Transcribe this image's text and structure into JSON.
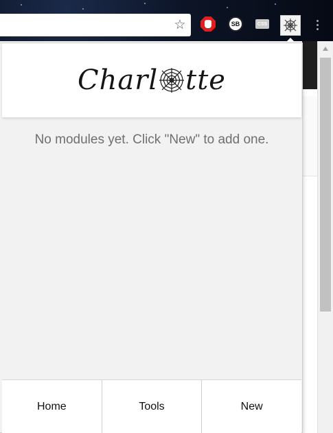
{
  "app": {
    "name": "Charlotte"
  },
  "popup": {
    "logo_prefix": "Charl",
    "logo_suffix": "tte",
    "empty_message": "No modules yet. Click \"New\" to add one.",
    "nav": {
      "home": "Home",
      "tools": "Tools",
      "new": "New"
    }
  },
  "toolbar": {
    "sb_label": "SB",
    "css_label": "CSS"
  },
  "icons": {
    "bookmark": "star-icon",
    "adblock": "adblock-stop-icon",
    "sb": "sb-extension-icon",
    "css": "css-extension-icon",
    "charlotte": "spiderweb-icon",
    "menu": "vertical-dots-icon"
  },
  "colors": {
    "popup_background": "#f2f2f2",
    "header_background": "#ffffff",
    "message_text": "#6f6f6f",
    "adblock_red": "#e02020"
  }
}
